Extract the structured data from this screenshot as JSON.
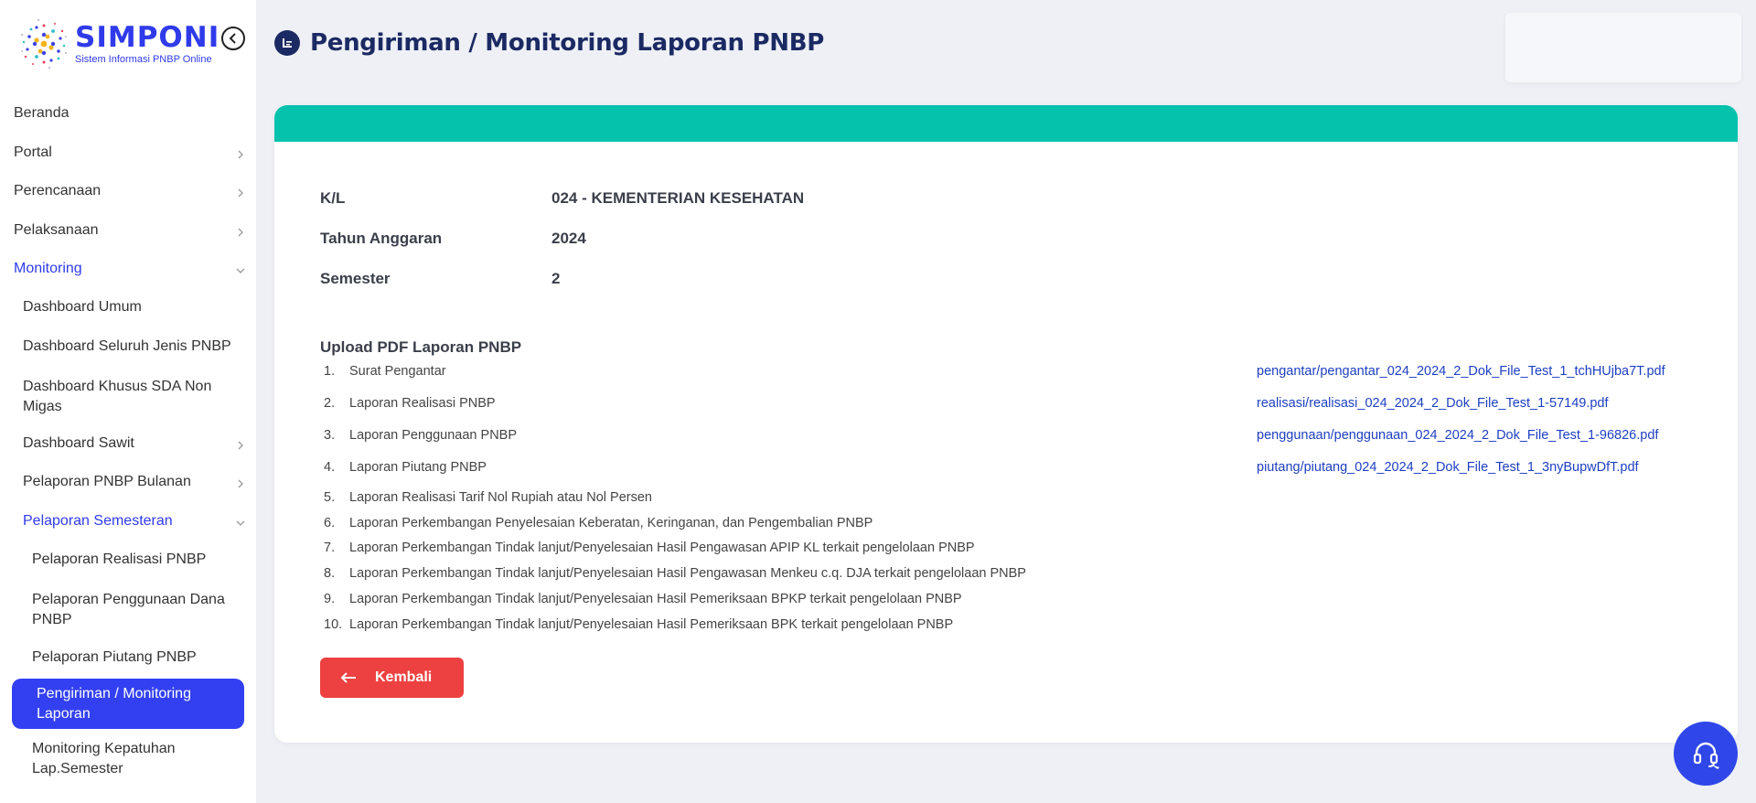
{
  "brand": {
    "title": "SIMPONI",
    "subtitle": "Sistem Informasi PNBP Online"
  },
  "sidebar": {
    "items": [
      {
        "label": "Beranda"
      },
      {
        "label": "Portal"
      },
      {
        "label": "Perencanaan"
      },
      {
        "label": "Pelaksanaan"
      },
      {
        "label": "Monitoring"
      },
      {
        "label": "Dashboard Umum"
      },
      {
        "label": "Dashboard Seluruh Jenis PNBP"
      },
      {
        "label": "Dashboard Khusus SDA Non Migas"
      },
      {
        "label": "Dashboard Sawit"
      },
      {
        "label": "Pelaporan PNBP Bulanan"
      },
      {
        "label": "Pelaporan Semesteran"
      },
      {
        "label": "Pelaporan Realisasi PNBP"
      },
      {
        "label": "Pelaporan Penggunaan Dana PNBP"
      },
      {
        "label": "Pelaporan Piutang PNBP"
      },
      {
        "label": "Pengiriman / Monitoring Laporan"
      },
      {
        "label": "Monitoring Kepatuhan Lap.Semester"
      }
    ]
  },
  "header": {
    "title": "Pengiriman / Monitoring Laporan PNBP"
  },
  "info": {
    "kl_label": "K/L",
    "kl_value": "024 - KEMENTERIAN KESEHATAN",
    "tahun_label": "Tahun Anggaran",
    "tahun_value": "2024",
    "semester_label": "Semester",
    "semester_value": "2"
  },
  "upload": {
    "title": "Upload PDF Laporan PNBP",
    "documents": [
      {
        "no": "1.",
        "name": "Surat Pengantar",
        "file": "pengantar/pengantar_024_2024_2_Dok_File_Test_1_tchHUjba7T.pdf"
      },
      {
        "no": "2.",
        "name": "Laporan Realisasi PNBP",
        "file": "realisasi/realisasi_024_2024_2_Dok_File_Test_1-57149.pdf"
      },
      {
        "no": "3.",
        "name": "Laporan Penggunaan PNBP",
        "file": "penggunaan/penggunaan_024_2024_2_Dok_File_Test_1-96826.pdf"
      },
      {
        "no": "4.",
        "name": "Laporan Piutang PNBP",
        "file": "piutang/piutang_024_2024_2_Dok_File_Test_1_3nyBupwDfT.pdf"
      },
      {
        "no": "5.",
        "name": "Laporan Realisasi Tarif Nol Rupiah atau Nol Persen",
        "file": ""
      },
      {
        "no": "6.",
        "name": "Laporan Perkembangan Penyelesaian Keberatan, Keringanan, dan Pengembalian PNBP",
        "file": ""
      },
      {
        "no": "7.",
        "name": "Laporan Perkembangan Tindak lanjut/Penyelesaian Hasil Pengawasan APIP KL terkait pengelolaan PNBP",
        "file": ""
      },
      {
        "no": "8.",
        "name": "Laporan Perkembangan Tindak lanjut/Penyelesaian Hasil Pengawasan Menkeu c.q. DJA terkait pengelolaan PNBP",
        "file": ""
      },
      {
        "no": "9.",
        "name": "Laporan Perkembangan Tindak lanjut/Penyelesaian Hasil Pemeriksaan BPKP terkait pengelolaan PNBP",
        "file": ""
      },
      {
        "no": "10.",
        "name": "Laporan Perkembangan Tindak lanjut/Penyelesaian Hasil Pemeriksaan BPK terkait pengelolaan PNBP",
        "file": ""
      }
    ]
  },
  "actions": {
    "back_label": "Kembali"
  },
  "colors": {
    "brand_blue": "#2f3bea",
    "header_navy": "#1b2a63",
    "band_teal": "#05c2ad",
    "danger_red": "#ec4140",
    "link_blue": "#1d3fc2"
  }
}
